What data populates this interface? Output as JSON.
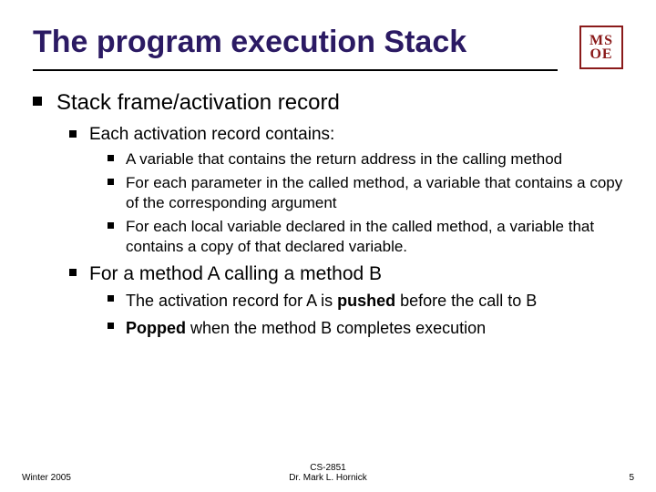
{
  "title": "The program execution Stack",
  "logo": {
    "line1": "MS",
    "line2": "OE"
  },
  "bullets": {
    "lvl1": "Stack frame/activation record",
    "lvl2a": "Each activation record contains:",
    "lvl2a_items": [
      "A variable that contains the return address in the calling method",
      "For each parameter in the called method, a variable that contains a copy of the corresponding argument",
      "For each local variable declared in the called method, a variable that contains a copy of that declared variable."
    ],
    "lvl2b": "For a method A calling a method B",
    "lvl2b_items": [
      {
        "pre": "The activation record for A is ",
        "bold": "pushed",
        "post": " before the call to B"
      },
      {
        "pre": "",
        "bold": "Popped",
        "post": " when the method B completes execution"
      }
    ]
  },
  "footer": {
    "left": "Winter 2005",
    "center1": "CS-2851",
    "center2": "Dr. Mark L. Hornick",
    "right": "5"
  }
}
